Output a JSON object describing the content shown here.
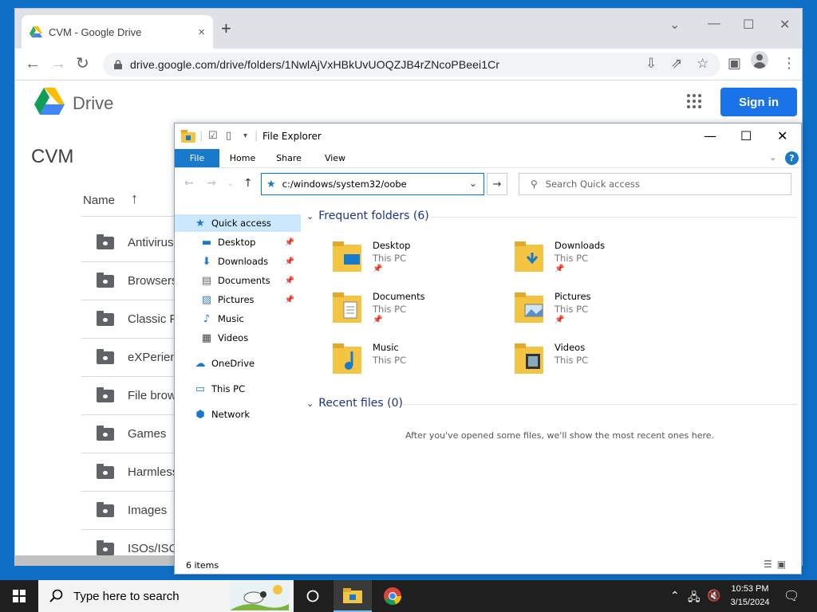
{
  "browser": {
    "tab_title": "CVM - Google Drive",
    "tab_close": "×",
    "new_tab": "+",
    "url": "drive.google.com/drive/folders/1NwlAjVxHBkUvUOQZJB4rZNcoPBeei1Cr"
  },
  "drive": {
    "app_name": "Drive",
    "sign_in": "Sign in",
    "folder_title": "CVM",
    "column_name": "Name",
    "sort_arrow": "↑",
    "rows": [
      "Antivirus",
      "Browsers",
      "Classic P",
      "eXPerien",
      "File brow",
      "Games",
      "Harmless",
      "Images",
      "ISOs/ISO"
    ]
  },
  "explorer": {
    "title": "File Explorer",
    "ribbon_tabs": [
      "File",
      "Home",
      "Share",
      "View"
    ],
    "help": "?",
    "address": "c:/windows/system32/oobe",
    "search_placeholder": "Search Quick access",
    "nav_pane": [
      {
        "label": "Quick access",
        "icon": "star-icon"
      },
      {
        "label": "Desktop",
        "icon": "desktop-icon",
        "pinned": true
      },
      {
        "label": "Downloads",
        "icon": "downloads-icon",
        "pinned": true
      },
      {
        "label": "Documents",
        "icon": "documents-icon",
        "pinned": true
      },
      {
        "label": "Pictures",
        "icon": "pictures-icon",
        "pinned": true
      },
      {
        "label": "Music",
        "icon": "music-icon"
      },
      {
        "label": "Videos",
        "icon": "videos-icon"
      },
      {
        "label": "OneDrive",
        "icon": "onedrive-icon"
      },
      {
        "label": "This PC",
        "icon": "this-pc-icon"
      },
      {
        "label": "Network",
        "icon": "network-icon"
      }
    ],
    "frequent_header": "Frequent folders (6)",
    "frequent": [
      {
        "name": "Desktop",
        "location": "This PC",
        "pinned": true
      },
      {
        "name": "Downloads",
        "location": "This PC",
        "pinned": true
      },
      {
        "name": "Documents",
        "location": "This PC",
        "pinned": true
      },
      {
        "name": "Pictures",
        "location": "This PC",
        "pinned": true
      },
      {
        "name": "Music",
        "location": "This PC",
        "pinned": false
      },
      {
        "name": "Videos",
        "location": "This PC",
        "pinned": false
      }
    ],
    "recent_header": "Recent files (0)",
    "recent_empty": "After you've opened some files, we'll show the most recent ones here.",
    "status": "6 items"
  },
  "taskbar": {
    "search_placeholder": "Type here to search",
    "time": "10:53 PM",
    "date": "3/15/2024"
  },
  "colors": {
    "accent_blue": "#1a73e8",
    "explorer_blue": "#1979ca",
    "desktop": "#0f6fc6"
  }
}
